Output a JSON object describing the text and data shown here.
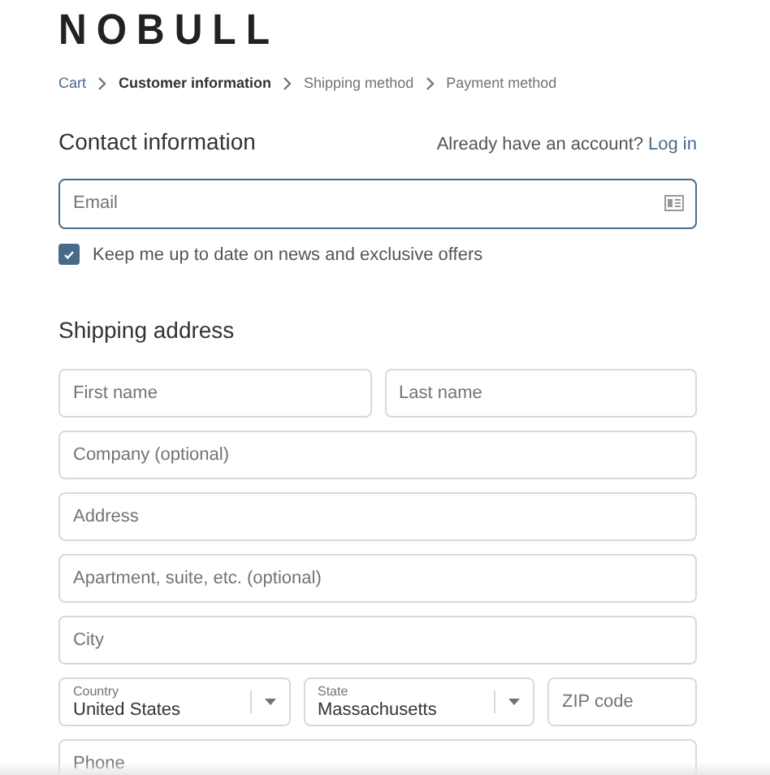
{
  "logo": "NOBULL",
  "breadcrumbs": [
    {
      "label": "Cart",
      "kind": "link"
    },
    {
      "label": "Customer information",
      "kind": "current"
    },
    {
      "label": "Shipping method",
      "kind": "step"
    },
    {
      "label": "Payment method",
      "kind": "step"
    }
  ],
  "contact": {
    "title": "Contact information",
    "account_prompt": "Already have an account?",
    "login_link": "Log in",
    "email": {
      "placeholder": "Email",
      "focused": true
    },
    "newsletter": {
      "label": "Keep me up to date on news and exclusive offers",
      "checked": true
    }
  },
  "shipping": {
    "title": "Shipping address",
    "rows": [
      [
        {
          "kind": "text",
          "placeholder": "First name"
        },
        {
          "kind": "text",
          "placeholder": "Last name"
        }
      ],
      [
        {
          "kind": "text",
          "placeholder": "Company (optional)"
        }
      ],
      [
        {
          "kind": "text",
          "placeholder": "Address"
        }
      ],
      [
        {
          "kind": "text",
          "placeholder": "Apartment, suite, etc. (optional)"
        }
      ],
      [
        {
          "kind": "text",
          "placeholder": "City"
        }
      ],
      [
        {
          "kind": "select",
          "label": "Country",
          "value": "United States"
        },
        {
          "kind": "select",
          "label": "State",
          "value": "Massachusetts"
        },
        {
          "kind": "text",
          "placeholder": "ZIP code"
        }
      ],
      [
        {
          "kind": "text",
          "placeholder": "Phone"
        }
      ]
    ]
  }
}
